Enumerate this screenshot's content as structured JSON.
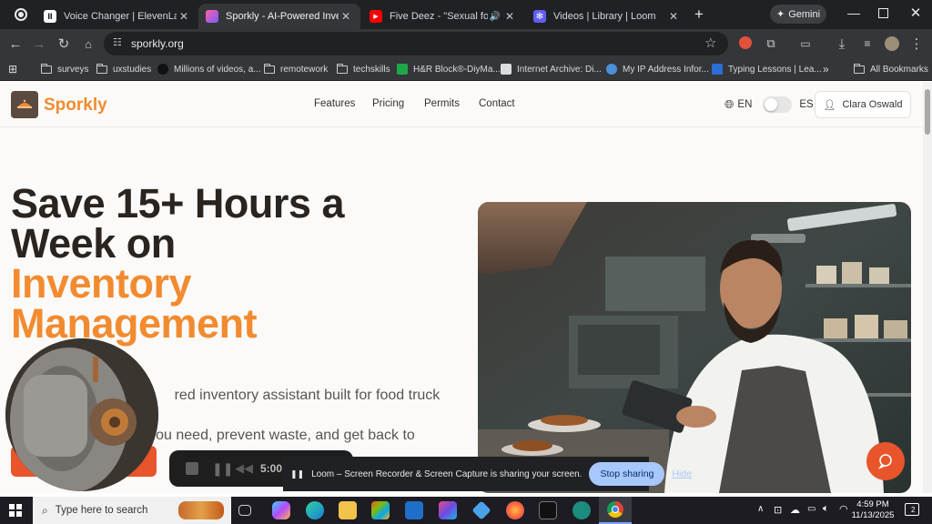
{
  "browser": {
    "tabs": [
      {
        "title": "Voice Changer | ElevenLabs",
        "active": false
      },
      {
        "title": "Sporkly - AI-Powered Inventory",
        "active": true
      },
      {
        "title": "Five Deez - \"Sexual for Eliza",
        "active": false
      },
      {
        "title": "Videos | Library | Loom",
        "active": false
      }
    ],
    "gemini_label": "Gemini",
    "url": "sporkly.org",
    "bookmarks": [
      "surveys",
      "uxstudies",
      "Millions of videos, a...",
      "remotework",
      "techskills",
      "H&R Block®-DiyMa...",
      "Internet Archive: Di...",
      "My IP Address Infor...",
      "Typing Lessons | Lea..."
    ],
    "bookmarks_more": "»",
    "all_bookmarks": "All Bookmarks"
  },
  "site": {
    "brand": "Sporkly",
    "nav": [
      "Features",
      "Pricing",
      "Permits",
      "Contact"
    ],
    "lang_en": "EN",
    "lang_es": "ES",
    "user": "Clara Oswald",
    "hero": {
      "title_line1": "Save 15+ Hours a",
      "title_line2": "Week on",
      "title_accent1": "Inventory",
      "title_accent2": "Management",
      "subtitle_line1": "S                                  red inventory assistant built for food truck",
      "subtitle_line2": "                              you need, prevent waste, and get back to"
    }
  },
  "loom": {
    "timer": "5:00",
    "share_text": "Loom – Screen Recorder & Screen Capture is sharing your screen.",
    "stop_label": "Stop sharing",
    "hide_label": "Hide"
  },
  "taskbar": {
    "search_placeholder": "Type here to search",
    "time": "4:59 PM",
    "date": "11/13/2025",
    "notification_count": "2"
  }
}
